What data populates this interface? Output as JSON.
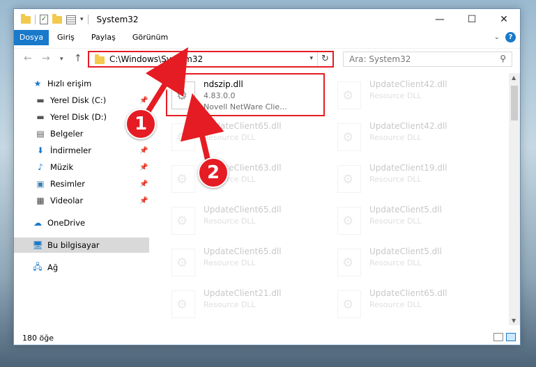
{
  "window": {
    "title": "System32"
  },
  "ribbon": {
    "tabs": [
      "Dosya",
      "Giriş",
      "Paylaş",
      "Görünüm"
    ]
  },
  "address": {
    "path": "C:\\Windows\\System32",
    "search_placeholder": "Ara: System32"
  },
  "nav": {
    "items": [
      {
        "label": "Hızlı erişim",
        "icon": "star-icon",
        "pinned": false
      },
      {
        "label": "Yerel Disk (C:)",
        "icon": "drive-icon",
        "pinned": true
      },
      {
        "label": "Yerel Disk (D:)",
        "icon": "drive-icon",
        "pinned": true
      },
      {
        "label": "Belgeler",
        "icon": "documents-icon",
        "pinned": true
      },
      {
        "label": "İndirmeler",
        "icon": "download-icon",
        "pinned": true
      },
      {
        "label": "Müzik",
        "icon": "music-icon",
        "pinned": true
      },
      {
        "label": "Resimler",
        "icon": "pictures-icon",
        "pinned": true
      },
      {
        "label": "Videolar",
        "icon": "video-icon",
        "pinned": true
      },
      {
        "label": "OneDrive",
        "icon": "cloud-icon",
        "pinned": false
      },
      {
        "label": "Bu bilgisayar",
        "icon": "computer-icon",
        "pinned": false,
        "selected": true
      },
      {
        "label": "Ağ",
        "icon": "network-icon",
        "pinned": false
      }
    ]
  },
  "files": {
    "left": [
      {
        "name": "ndszip.dll",
        "version": "4.83.0.0",
        "desc": "Novell NetWare Clie..."
      },
      {
        "name": "UpdateClient65.dll",
        "desc": "Resource DLL"
      },
      {
        "name": "UpdateClient63.dll",
        "desc": "Resource DLL"
      },
      {
        "name": "UpdateClient65.dll",
        "desc": "Resource DLL"
      },
      {
        "name": "UpdateClient65.dll",
        "desc": "Resource DLL"
      },
      {
        "name": "UpdateClient21.dll",
        "desc": "Resource DLL"
      }
    ],
    "right": [
      {
        "name": "UpdateClient42.dll",
        "desc": "Resource DLL"
      },
      {
        "name": "UpdateClient42.dll",
        "desc": "Resource DLL"
      },
      {
        "name": "UpdateClient19.dll",
        "desc": "Resource DLL"
      },
      {
        "name": "UpdateClient5.dll",
        "desc": "Resource DLL"
      },
      {
        "name": "UpdateClient5.dll",
        "desc": "Resource DLL"
      },
      {
        "name": "UpdateClient65.dll",
        "desc": "Resource DLL"
      }
    ]
  },
  "status": {
    "count": "180 öğe"
  },
  "callouts": [
    "1",
    "2"
  ],
  "colors": {
    "accent": "#1979ca",
    "callout": "#e51c23"
  }
}
